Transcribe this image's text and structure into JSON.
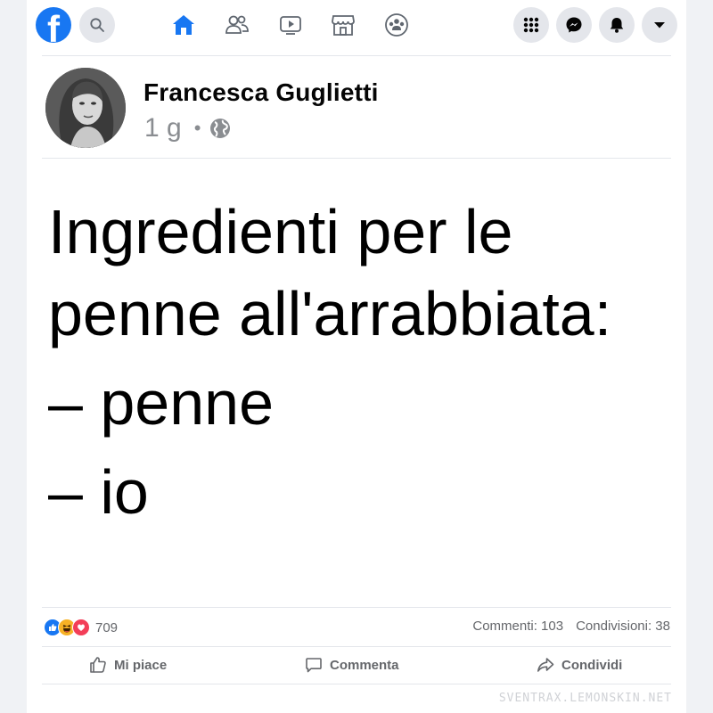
{
  "nav": {
    "logo_letter": "f",
    "left": [
      "search-icon"
    ],
    "center": [
      "home-icon",
      "friends-icon",
      "watch-icon",
      "marketplace-icon",
      "groups-icon"
    ],
    "right": [
      "menu-grid-icon",
      "messenger-icon",
      "notifications-icon",
      "account-dropdown-icon"
    ],
    "active": "home-icon",
    "accent": "#1877f2"
  },
  "post": {
    "author": "Francesca Guglietti",
    "time": "1 g",
    "separator": "•",
    "privacy_icon": "globe-icon",
    "lines": [
      "Ingredienti per le",
      "penne all'arrabbiata:",
      "– penne",
      "– io"
    ],
    "reactions": [
      "like-reaction-icon",
      "haha-reaction-icon",
      "love-reaction-icon"
    ],
    "reaction_count": "709",
    "comments": "Commenti: 103",
    "shares": "Condivisioni: 38",
    "actions": {
      "like": "Mi piace",
      "comment": "Commenta",
      "share": "Condividi"
    }
  },
  "watermark": "SVENTRAX.LEMONSKIN.NET"
}
